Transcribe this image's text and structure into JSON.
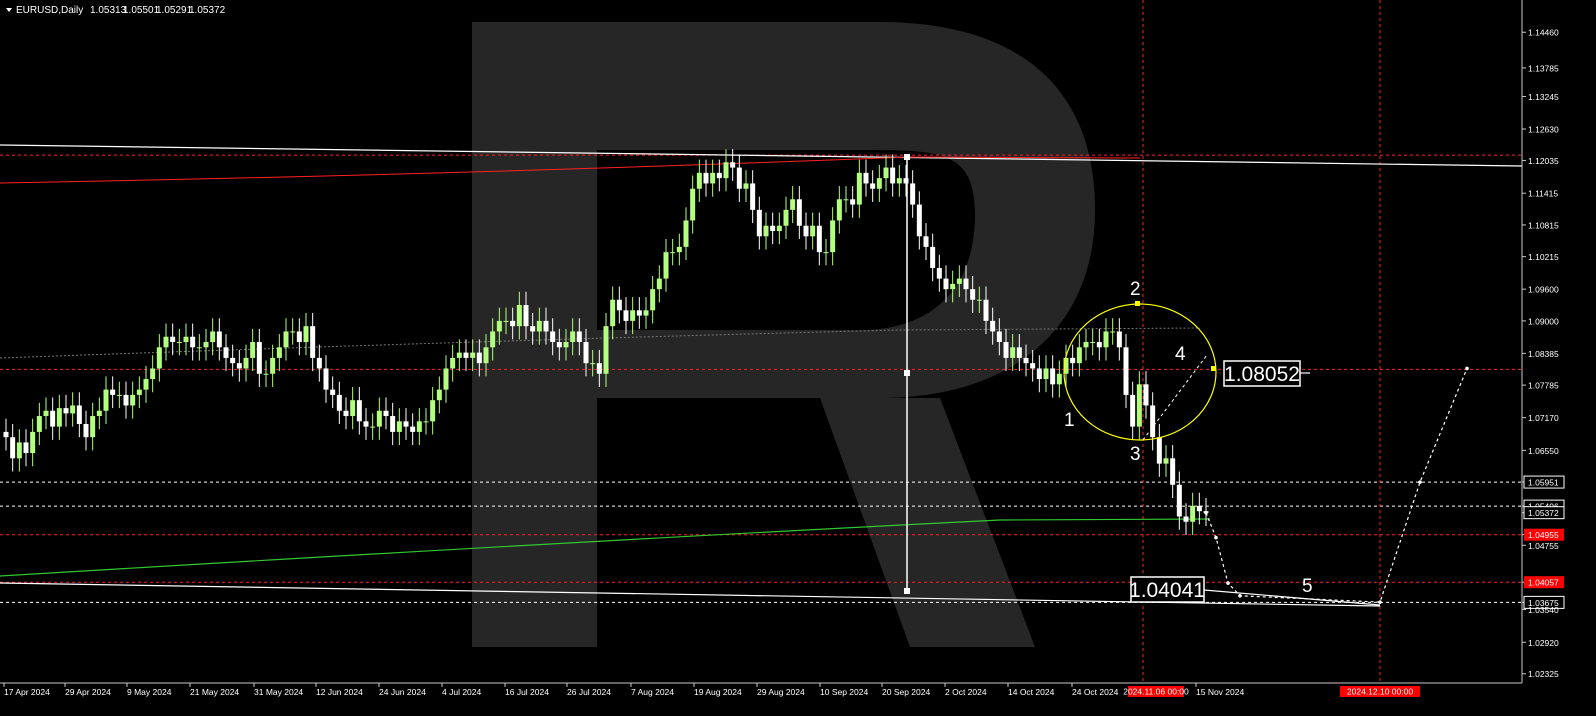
{
  "header": {
    "symbol": "EURUSD,Daily",
    "open": "1.05313",
    "high": "1.05501",
    "low": "1.05291",
    "close": "1.05372"
  },
  "colors": {
    "background": "#000000",
    "bull": "#b3ff80",
    "bear": "#ffffff",
    "red_line": "#ff2020",
    "green_ma": "#32c832",
    "ellipse": "#ffff00",
    "tag_red": "#ff0000"
  },
  "chart_data": {
    "type": "candlestick",
    "ylim": [
      1.0215,
      1.1507
    ],
    "y_ticks": [
      "1.14460",
      "1.13785",
      "1.13245",
      "1.12630",
      "1.12035",
      "1.11415",
      "1.10815",
      "1.10215",
      "1.09600",
      "1.09000",
      "1.08385",
      "1.07785",
      "1.07170",
      "1.06550",
      "1.05951",
      "1.05496",
      "1.05372",
      "1.04955",
      "1.04755",
      "1.04057",
      "1.03675",
      "1.03540",
      "1.02920",
      "1.02325"
    ],
    "x_labels": [
      "17 Apr 2024",
      "29 Apr 2024",
      "9 May 2024",
      "21 May 2024",
      "31 May 2024",
      "12 Jun 2024",
      "24 Jun 2024",
      "4 Jul 2024",
      "16 Jul 2024",
      "26 Jul 2024",
      "7 Aug 2024",
      "19 Aug 2024",
      "29 Aug 2024",
      "10 Sep 2024",
      "20 Sep 2024",
      "2 Oct 2024",
      "14 Oct 2024",
      "24 Oct 2024",
      "15 Nov 2024"
    ],
    "x_tag_left": "2024.11.06 00:00",
    "x_tag_right": "2024.12.10 00:00",
    "level_tags": {
      "top": "1.12135",
      "mid": "1.08083",
      "lower": "1.04955",
      "bottom": "1.04057",
      "l_1_05951": "1.05951",
      "l_1_05496": "1.05496",
      "l_1_05372": "1.05372",
      "l_1_03675": "1.03675"
    },
    "annotation_boxes": [
      "1.08052",
      "1.04041"
    ],
    "wave_labels": [
      "1",
      "2",
      "3",
      "4",
      "5"
    ],
    "close": [
      1.068,
      1.064,
      1.067,
      1.065,
      1.069,
      1.072,
      1.073,
      1.07,
      1.0735,
      1.0725,
      1.074,
      1.0705,
      1.068,
      1.072,
      1.073,
      1.077,
      1.076,
      1.076,
      1.074,
      1.076,
      1.077,
      1.079,
      1.081,
      1.085,
      1.087,
      1.086,
      1.086,
      1.087,
      1.085,
      1.085,
      1.086,
      1.088,
      1.085,
      1.083,
      1.082,
      1.081,
      1.083,
      1.086,
      1.08,
      1.08,
      1.083,
      1.085,
      1.088,
      1.088,
      1.086,
      1.089,
      1.083,
      1.081,
      1.077,
      1.076,
      1.073,
      1.072,
      1.075,
      1.071,
      1.07,
      1.07,
      1.073,
      1.072,
      1.069,
      1.071,
      1.07,
      1.069,
      1.071,
      1.071,
      1.075,
      1.077,
      1.081,
      1.083,
      1.084,
      1.083,
      1.084,
      1.082,
      1.085,
      1.088,
      1.09,
      1.09,
      1.089,
      1.093,
      1.089,
      1.088,
      1.09,
      1.088,
      1.086,
      1.085,
      1.086,
      1.088,
      1.086,
      1.082,
      1.082,
      1.08,
      1.089,
      1.094,
      1.092,
      1.09,
      1.092,
      1.091,
      1.092,
      1.096,
      1.098,
      1.103,
      1.103,
      1.104,
      1.109,
      1.115,
      1.118,
      1.116,
      1.118,
      1.117,
      1.12,
      1.119,
      1.115,
      1.116,
      1.111,
      1.106,
      1.108,
      1.107,
      1.108,
      1.111,
      1.113,
      1.108,
      1.106,
      1.108,
      1.103,
      1.103,
      1.109,
      1.113,
      1.113,
      1.112,
      1.118,
      1.116,
      1.115,
      1.117,
      1.119,
      1.116,
      1.117,
      1.116,
      1.112,
      1.106,
      1.104,
      1.1,
      1.098,
      1.096,
      1.097,
      1.098,
      1.096,
      1.094,
      1.094,
      1.09,
      1.088,
      1.086,
      1.083,
      1.085,
      1.083,
      1.082,
      1.081,
      1.079,
      1.081,
      1.078,
      1.08,
      1.083,
      1.082,
      1.085,
      1.086,
      1.086,
      1.085,
      1.088,
      1.088,
      1.085,
      1.076,
      1.07,
      1.078,
      1.074,
      1.068,
      1.063,
      1.064,
      1.059,
      1.053,
      1.052,
      1.055,
      1.054,
      1.0537
    ],
    "forecast_path": [
      [
        1.0537,
        1.049
      ],
      [
        1.0404,
        1.038
      ],
      [
        1.0368,
        1.0595
      ],
      [
        1.081
      ]
    ]
  }
}
